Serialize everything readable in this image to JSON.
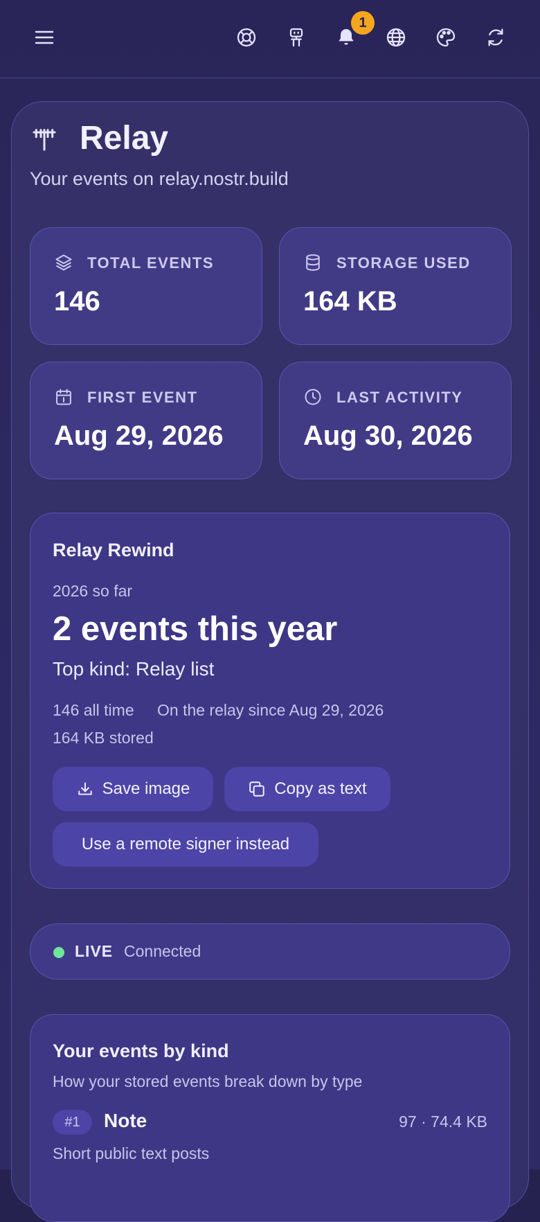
{
  "topbar": {
    "icons": [
      "menu-icon",
      "lifebuoy-icon",
      "robot-icon",
      "bell-icon",
      "globe-icon",
      "palette-icon",
      "refresh-icon"
    ],
    "notification_count": "1"
  },
  "relay": {
    "title": "Relay",
    "subtitle": "Your events on relay.nostr.build"
  },
  "stats": [
    {
      "label": "TOTAL EVENTS",
      "value": "146",
      "icon": "layers-icon"
    },
    {
      "label": "STORAGE USED",
      "value": "164 KB",
      "icon": "database-icon"
    },
    {
      "label": "FIRST EVENT",
      "value": "Aug 29, 2026",
      "icon": "calendar-icon"
    },
    {
      "label": "LAST ACTIVITY",
      "value": "Aug 30, 2026",
      "icon": "clock-icon"
    }
  ],
  "rewind": {
    "title": "Relay Rewind",
    "period": "2026 so far",
    "count": "2 events this year",
    "top_kind": "Top kind: Relay list",
    "all_time": "146 all time",
    "since": "On the relay since Aug 29, 2026",
    "stored": "164 KB stored",
    "save_label": "Save image",
    "copy_label": "Copy as text",
    "signer_label": "Use a remote signer instead"
  },
  "live": {
    "label": "LIVE",
    "status": "Connected",
    "color": "#6ee79a"
  },
  "kinds": {
    "title": "Your events by kind",
    "subtitle": "How your stored events break down by type",
    "items": [
      {
        "rank": "#1",
        "name": "Note",
        "stats": "97 · 74.4 KB",
        "description": "Short public text posts"
      }
    ]
  },
  "colors": {
    "background": "#2a2558",
    "card": "#413b86",
    "button": "#4c44a6",
    "badge": "#f4a71d"
  }
}
